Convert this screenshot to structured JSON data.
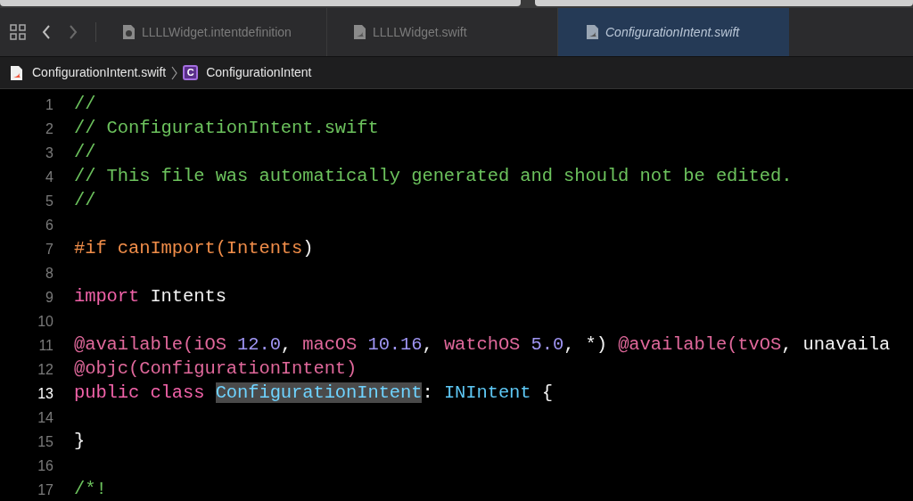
{
  "tab_bar": {
    "tabs": [
      {
        "label": "LLLLWidget.intentdefinition",
        "kind": "intents",
        "selected": false
      },
      {
        "label": "LLLLWidget.swift",
        "kind": "swift",
        "selected": false
      },
      {
        "label": "ConfigurationIntent.swift",
        "kind": "swift",
        "selected": true
      }
    ]
  },
  "breadcrumb": {
    "file": "ConfigurationIntent.swift",
    "symbol_badge": "C",
    "symbol": "ConfigurationIntent"
  },
  "editor": {
    "lines": [
      {
        "number": "1",
        "current": false,
        "tokens": [
          {
            "kind": "comment",
            "text": "//"
          }
        ]
      },
      {
        "number": "2",
        "current": false,
        "tokens": [
          {
            "kind": "comment",
            "text": "// ConfigurationIntent.swift"
          }
        ]
      },
      {
        "number": "3",
        "current": false,
        "tokens": [
          {
            "kind": "comment",
            "text": "//"
          }
        ]
      },
      {
        "number": "4",
        "current": false,
        "tokens": [
          {
            "kind": "comment",
            "text": "// This file was automatically generated and should not be edited."
          }
        ]
      },
      {
        "number": "5",
        "current": false,
        "tokens": [
          {
            "kind": "comment",
            "text": "//"
          }
        ]
      },
      {
        "number": "6",
        "current": false
      },
      {
        "number": "7",
        "current": false,
        "tokens": [
          {
            "kind": "directive",
            "text": "#if canImport(Intents"
          },
          {
            "kind": "plain",
            "text": ")"
          }
        ]
      },
      {
        "number": "8",
        "current": false
      },
      {
        "number": "9",
        "current": false,
        "tokens": [
          {
            "kind": "keyword",
            "text": "import"
          },
          {
            "kind": "plain",
            "text": " Intents"
          }
        ]
      },
      {
        "number": "10",
        "current": false
      },
      {
        "number": "11",
        "current": false,
        "tokens": [
          {
            "kind": "attribute",
            "text": "@available(iOS "
          },
          {
            "kind": "number",
            "text": "12.0"
          },
          {
            "kind": "plain",
            "text": ", "
          },
          {
            "kind": "attribute",
            "text": "macOS "
          },
          {
            "kind": "number",
            "text": "10.16"
          },
          {
            "kind": "plain",
            "text": ", "
          },
          {
            "kind": "attribute",
            "text": "watchOS "
          },
          {
            "kind": "number",
            "text": "5.0"
          },
          {
            "kind": "plain",
            "text": ", *) "
          },
          {
            "kind": "attribute",
            "text": "@available(tvOS"
          },
          {
            "kind": "plain",
            "text": ", unavaila"
          }
        ]
      },
      {
        "number": "12",
        "current": false,
        "tokens": [
          {
            "kind": "attribute",
            "text": "@objc(ConfigurationIntent)"
          }
        ]
      },
      {
        "number": "13",
        "current": true,
        "tokens": [
          {
            "kind": "keyword",
            "text": "public class "
          },
          {
            "kind": "highlighted",
            "text": "ConfigurationIntent"
          },
          {
            "kind": "plain",
            "text": ": "
          },
          {
            "kind": "type",
            "text": "INIntent"
          },
          {
            "kind": "plain",
            "text": " {"
          }
        ]
      },
      {
        "number": "14",
        "current": false
      },
      {
        "number": "15",
        "current": false,
        "tokens": [
          {
            "kind": "plain",
            "text": "}"
          }
        ]
      },
      {
        "number": "16",
        "current": false
      },
      {
        "number": "17",
        "current": false,
        "tokens": [
          {
            "kind": "comment",
            "text": "/*!"
          }
        ]
      }
    ]
  }
}
